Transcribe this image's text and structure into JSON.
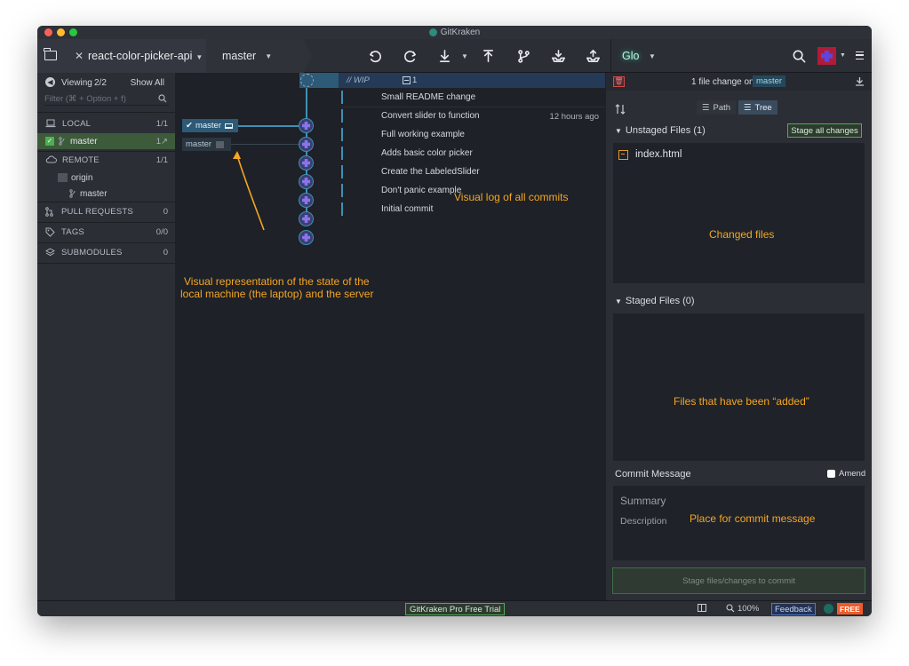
{
  "window": {
    "title": "GitKraken"
  },
  "toolbar": {
    "repo_name": "react-color-picker-api",
    "branch_name": "master",
    "glo_label": "Glo"
  },
  "sidebar": {
    "viewing_label": "Viewing",
    "viewing_count": "2/2",
    "show_all": "Show All",
    "filter_placeholder": "Filter (⌘ + Option + f)",
    "local": {
      "label": "LOCAL",
      "count": "1/1",
      "branch": "master",
      "branch_count": "1↗"
    },
    "remote": {
      "label": "REMOTE",
      "count": "1/1",
      "origin": "origin",
      "branch": "master"
    },
    "pull_requests": {
      "label": "PULL REQUESTS",
      "count": "0"
    },
    "tags": {
      "label": "TAGS",
      "count": "0/0"
    },
    "submodules": {
      "label": "SUBMODULES",
      "count": "0"
    }
  },
  "graph": {
    "wip_label": "// WIP",
    "wip_count": "1",
    "local_branch": "master",
    "remote_branch": "master",
    "commits": [
      {
        "message": "Small README change",
        "time": ""
      },
      {
        "message": "Convert slider to function",
        "time": "12 hours ago"
      },
      {
        "message": "Full working example",
        "time": ""
      },
      {
        "message": "Adds basic color picker",
        "time": ""
      },
      {
        "message": "Create the LabeledSlider",
        "time": ""
      },
      {
        "message": "Don't panic example",
        "time": ""
      },
      {
        "message": "Initial commit",
        "time": ""
      }
    ],
    "annotation_log": "Visual log of all commits",
    "annotation_state_line1": "Visual representation of the state of the",
    "annotation_state_line2": "local machine (the laptop) and the server"
  },
  "right_panel": {
    "header_prefix": "1 file change on",
    "header_branch": "master",
    "path_label": "Path",
    "tree_label": "Tree",
    "unstaged_label": "Unstaged Files (1)",
    "stage_all_label": "Stage all changes",
    "unstaged_files": [
      "index.html"
    ],
    "annotation_changed": "Changed files",
    "staged_label": "Staged Files (0)",
    "annotation_added": "Files that have been “added”",
    "commit_message_label": "Commit Message",
    "amend_label": "Amend",
    "summary_placeholder": "Summary",
    "description_placeholder": "Description",
    "annotation_commit": "Place for commit message",
    "stage_commit_button": "Stage files/changes to commit"
  },
  "statusbar": {
    "trial_label": "GitKraken Pro Free Trial",
    "zoom": "100%",
    "feedback_label": "Feedback",
    "free_label": "FREE"
  },
  "colors": {
    "accent_orange": "#f5a623",
    "graph_blue": "#3e90b5",
    "stage_green": "#4caf50",
    "free_badge": "#f05a28"
  }
}
